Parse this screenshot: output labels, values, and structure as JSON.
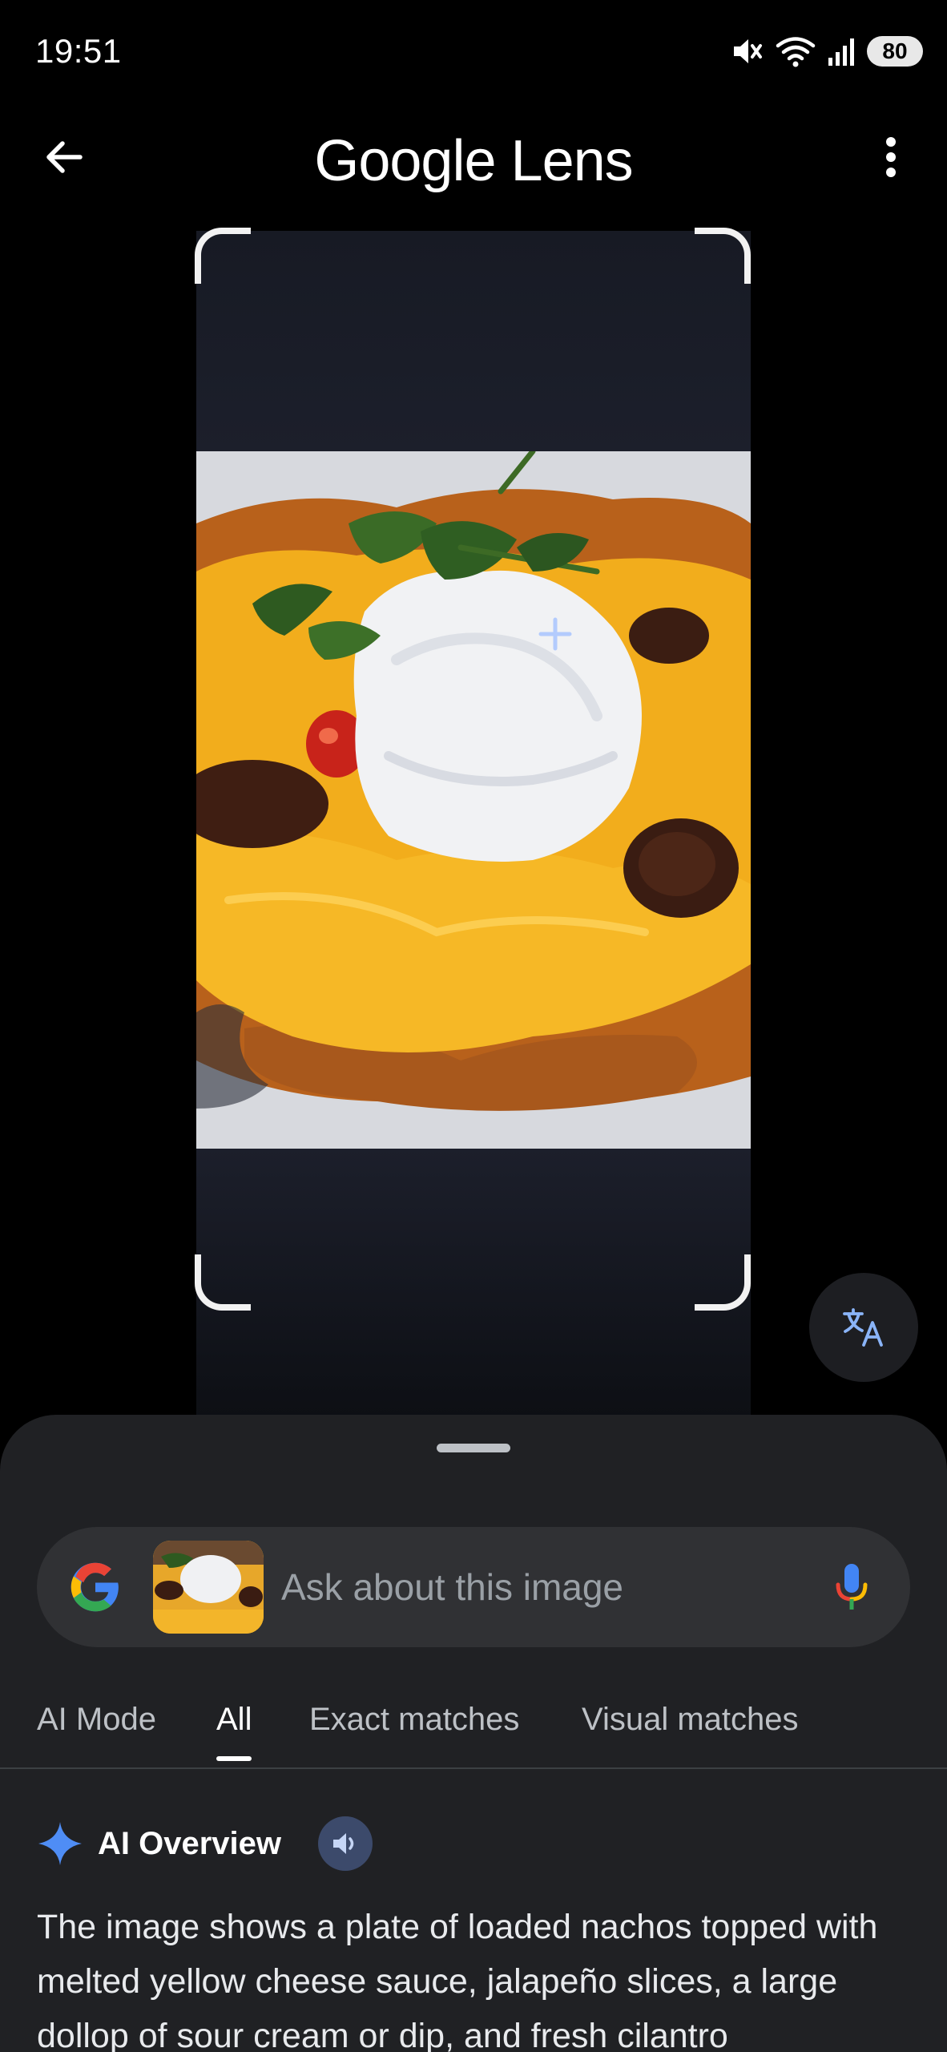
{
  "status_bar": {
    "time": "19:51",
    "battery": "80",
    "icons": [
      "mute-icon",
      "wifi-icon",
      "signal-icon",
      "battery-icon"
    ]
  },
  "app_bar": {
    "title": "Google Lens",
    "back_icon": "arrow-back-icon",
    "more_icon": "more-vert-icon"
  },
  "lens": {
    "translate_icon": "translate-icon"
  },
  "search": {
    "placeholder": "Ask about this image",
    "logo_icon": "google-g-icon",
    "mic_icon": "mic-icon"
  },
  "tabs": [
    {
      "label": "AI Mode",
      "active": false
    },
    {
      "label": "All",
      "active": true
    },
    {
      "label": "Exact matches",
      "active": false
    },
    {
      "label": "Visual matches",
      "active": false
    }
  ],
  "ai_overview": {
    "title": "AI Overview",
    "sparkle_icon": "sparkle-icon",
    "speaker_icon": "speaker-icon",
    "text": "The image shows a plate of loaded nachos topped with melted yellow cheese sauce, jalapeño slices, a large dollop of sour cream or dip, and fresh cilantro"
  },
  "colors": {
    "background": "#000000",
    "sheet": "#202124",
    "search_bar": "#303134",
    "accent_blue": "#8ab4f8",
    "google_blue": "#4285F4",
    "google_red": "#EA4335",
    "google_yellow": "#FBBC05",
    "google_green": "#34A853"
  }
}
